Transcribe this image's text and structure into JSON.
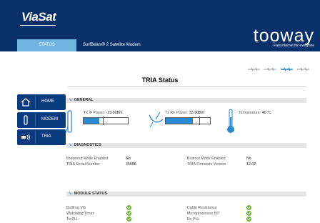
{
  "header": {
    "brand": "ViaSat",
    "partner_logo": "tooway",
    "partner_tagline": "Fast internet for everyone",
    "tab_label": "STATUS",
    "device_title": "SurfBeam® 2 Satellite Modem"
  },
  "page_title": "TRIA Status",
  "nav": [
    {
      "label": "HOME",
      "icon": "house-icon"
    },
    {
      "label": "MODEM",
      "icon": "modem-icon"
    },
    {
      "label": "TRIA",
      "icon": "tria-icon"
    }
  ],
  "general": {
    "title": "GENERAL",
    "tx_if_label": "Tx IF Power:",
    "tx_if_value": "-23.9dBm",
    "tx_if_level": 0.35,
    "tx_rf_label": "Tx RF Power:",
    "tx_rf_value": "33.9dBm",
    "tx_rf_level": 0.62,
    "temp_label": "Temperature:",
    "temp_value": "40 °C"
  },
  "diagnostics": {
    "title": "DIAGNOSTICS",
    "brownout_label": "Brownout Mode Enabled",
    "brownout_value": "No",
    "serial_label": "TRIA Serial Number",
    "serial_value": "35056",
    "blueout_label": "Blueout Mode Enabled",
    "blueout_value": "No",
    "firmware_label": "TRIA Firmware Version",
    "firmware_value": "12.02"
  },
  "module_status": {
    "title": "MODULE STATUS",
    "left": [
      "Bullfrog VG",
      "Watchdog Timer",
      "Tx PLL"
    ],
    "right": [
      "Cable Resistance",
      "Microprocessor BIT",
      "Rx PLL"
    ]
  },
  "colors": {
    "header": "#08306a",
    "accent": "#2a8ad0",
    "ok": "#6ab82c"
  }
}
